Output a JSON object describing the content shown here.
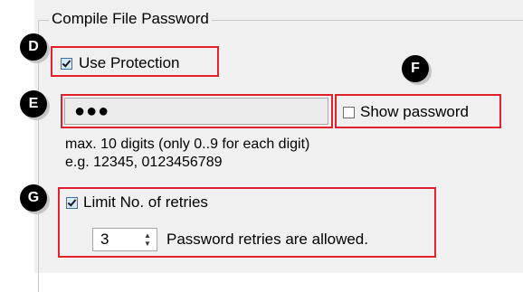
{
  "group": {
    "title": "Compile File Password"
  },
  "protection": {
    "label": "Use Protection",
    "checked": true
  },
  "password": {
    "value": "●●●"
  },
  "show_password": {
    "label": "Show password",
    "checked": false
  },
  "hint": {
    "line1": "max. 10 digits (only 0..9 for each digit)",
    "line2": "e.g. 12345, 0123456789"
  },
  "retries": {
    "label": "Limit No. of retries",
    "checked": true,
    "value": "3",
    "suffix": "Password retries are allowed."
  },
  "markers": {
    "d": "D",
    "e": "E",
    "f": "F",
    "g": "G"
  },
  "colors": {
    "highlight": "#e0202a",
    "panel": "#f0f0f0",
    "marker": "#000000"
  }
}
